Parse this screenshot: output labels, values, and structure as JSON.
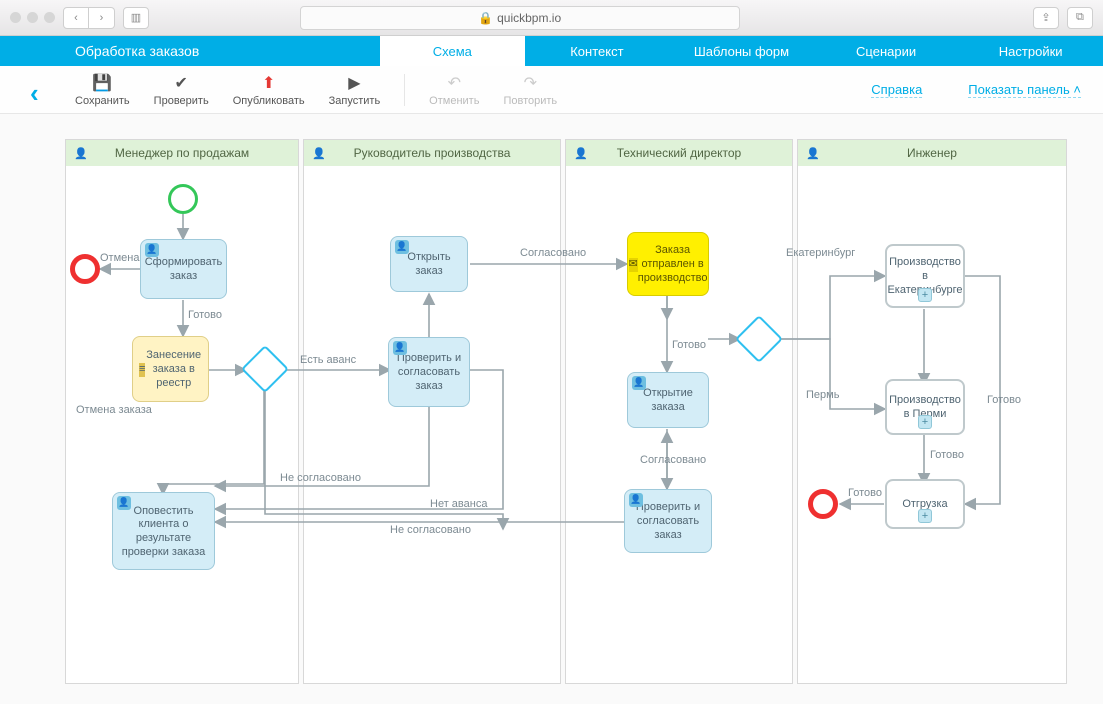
{
  "browser": {
    "url": "quickbpm.io"
  },
  "header": {
    "title": "Обработка заказов",
    "tabs": [
      "Схема",
      "Контекст",
      "Шаблоны форм",
      "Сценарии",
      "Настройки"
    ],
    "activeTab": 0
  },
  "toolbar": {
    "save": "Сохранить",
    "check": "Проверить",
    "publish": "Опубликовать",
    "run": "Запустить",
    "undo": "Отменить",
    "redo": "Повторить",
    "help": "Справка",
    "panel": "Показать панель"
  },
  "lanes": [
    {
      "title": "Менеджер по продажам"
    },
    {
      "title": "Руководитель производства"
    },
    {
      "title": "Технический директор"
    },
    {
      "title": "Инженер"
    }
  ],
  "nodes": {
    "n1": "Сформировать заказ",
    "n2": "Занесение заказа в реестр",
    "n3": "Оповестить клиента о результате проверки заказа",
    "n4": "Открыть заказ",
    "n5": "Проверить и согласовать заказ",
    "n6": "Заказа отправлен в производство",
    "n7": "Открытие заказа",
    "n8": "Проверить и согласовать заказ",
    "n9": "Производство в Екатеринбурге",
    "n10": "Производство в Перми",
    "n11": "Отгрузка"
  },
  "labels": {
    "l_cancel": "Отмена",
    "l_ready": "Готово",
    "l_cancelOrd": "Отмена заказа",
    "l_avans": "Есть аванс",
    "l_sogl": "Согласовано",
    "l_noavans": "Нет аванса",
    "l_nesogl1": "Не согласовано",
    "l_nesogl2": "Не согласовано",
    "l_ready2": "Готово",
    "l_sogl2": "Согласовано",
    "l_ekb": "Екатеринбург",
    "l_perm": "Пермь",
    "l_ready3": "Готово",
    "l_ready4": "Готово",
    "l_ready5": "Готово"
  }
}
